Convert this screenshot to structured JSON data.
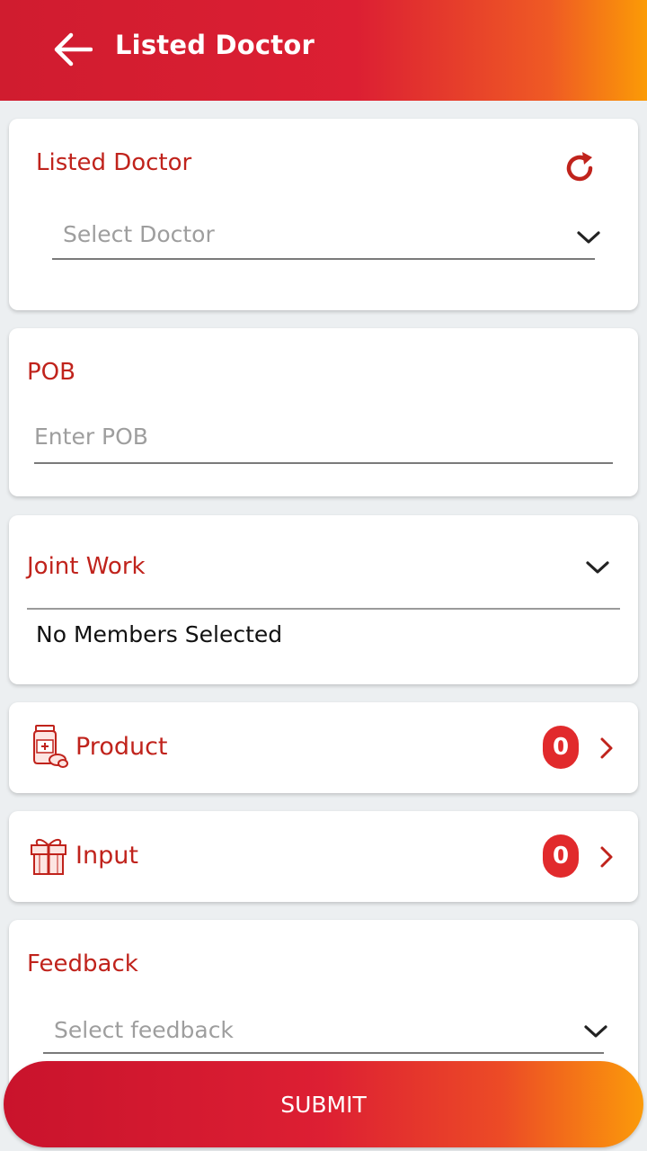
{
  "appbar": {
    "title": "Listed Doctor"
  },
  "listed_doctor": {
    "label": "Listed Doctor",
    "placeholder": "Select Doctor"
  },
  "pob": {
    "label": "POB",
    "placeholder": "Enter POB"
  },
  "joint_work": {
    "label": "Joint Work",
    "status": "No Members Selected"
  },
  "product": {
    "label": "Product",
    "count": "0",
    "icon": "medicine-icon"
  },
  "input": {
    "label": "Input",
    "count": "0",
    "icon": "gift-icon"
  },
  "feedback": {
    "label": "Feedback",
    "placeholder": "Select feedback"
  },
  "submit_label": "SUBMIT",
  "colors": {
    "accent_red": "#c0231c",
    "gradient_start": "#d01c2f",
    "gradient_end": "#fb9b06",
    "badge": "#e12a2c"
  }
}
